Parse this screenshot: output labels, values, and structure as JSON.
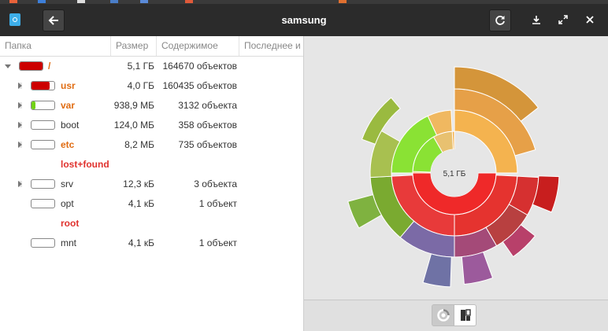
{
  "window": {
    "title": "samsung"
  },
  "columns": {
    "folder": "Папка",
    "size": "Размер",
    "contents": "Содержимое",
    "modified": "Последнее и"
  },
  "rows": [
    {
      "name": "/",
      "size": "5,1 ГБ",
      "count": "164670 объектов",
      "fill": 1.0,
      "fill_color": "#cc0000",
      "style": "orange"
    },
    {
      "name": "usr",
      "size": "4,0 ГБ",
      "count": "160435 объектов",
      "fill": 0.78,
      "fill_color": "#cc0000",
      "style": "orange"
    },
    {
      "name": "var",
      "size": "938,9 МБ",
      "count": "3132 объекта",
      "fill": 0.18,
      "fill_color": "#73d216",
      "style": "orange"
    },
    {
      "name": "boot",
      "size": "124,0 МБ",
      "count": "358 объектов",
      "fill": 0,
      "fill_color": "#ffffff",
      "style": "normal"
    },
    {
      "name": "etc",
      "size": "8,2 МБ",
      "count": "735 объектов",
      "fill": 0,
      "fill_color": "#ffffff",
      "style": "orange"
    },
    {
      "name": "lost+found",
      "size": "",
      "count": "",
      "fill": 0,
      "fill_color": "#ffffff",
      "style": "red"
    },
    {
      "name": "srv",
      "size": "12,3 кБ",
      "count": "3 объекта",
      "fill": 0,
      "fill_color": "#ffffff",
      "style": "normal"
    },
    {
      "name": "opt",
      "size": "4,1 кБ",
      "count": "1 объект",
      "fill": 0,
      "fill_color": "#ffffff",
      "style": "normal"
    },
    {
      "name": "root",
      "size": "",
      "count": "",
      "fill": 0,
      "fill_color": "#ffffff",
      "style": "red"
    },
    {
      "name": "mnt",
      "size": "4,1 кБ",
      "count": "1 объект",
      "fill": 0,
      "fill_color": "#ffffff",
      "style": "normal"
    }
  ],
  "chart": {
    "center_label": "5,1 ГБ"
  },
  "icons": {
    "app": "disk-usage-analyzer-icon",
    "back": "arrow-left-icon",
    "reload": "reload-icon",
    "save": "download-icon",
    "fullscreen": "fullscreen-icon",
    "close": "close-icon",
    "ring_view": "ring-chart-icon",
    "treemap_view": "treemap-icon"
  },
  "colors": {
    "red": "#cc0000",
    "orange": "#e06c12",
    "green": "#73d216",
    "headerbar": "#2b2b2b"
  }
}
